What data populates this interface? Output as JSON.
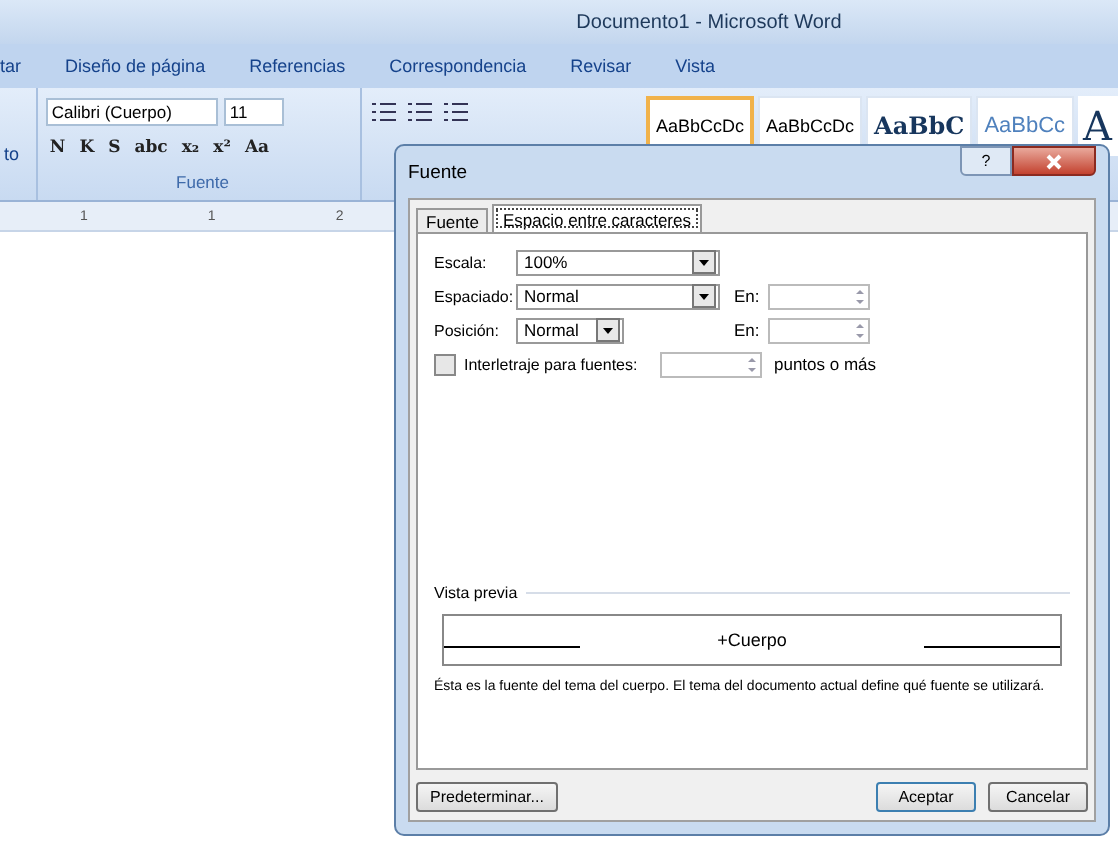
{
  "window": {
    "title": "Documento1 - Microsoft Word"
  },
  "ribbon_tabs": [
    {
      "label": "tar",
      "selected": false
    },
    {
      "label": "Diseño de página",
      "selected": false
    },
    {
      "label": "Referencias",
      "selected": false
    },
    {
      "label": "Correspondencia",
      "selected": false
    },
    {
      "label": "Revisar",
      "selected": false
    },
    {
      "label": "Vista",
      "selected": false
    }
  ],
  "left_group": {
    "label": "to"
  },
  "font_group": {
    "label": "Fuente",
    "font_name": "Calibri (Cuerpo)",
    "font_size": "11",
    "format_buttons": [
      "N",
      "K",
      "S",
      "abc",
      "x₂",
      "x²",
      "Aa"
    ]
  },
  "styles_gallery": [
    {
      "sample": "AaBbCcDc",
      "selected": true,
      "kind": "normal"
    },
    {
      "sample": "AaBbCcDc",
      "selected": false,
      "kind": "normal"
    },
    {
      "sample": "AaBbC",
      "selected": false,
      "kind": "heading1"
    },
    {
      "sample": "AaBbCc",
      "selected": false,
      "kind": "heading2"
    },
    {
      "sample": "A",
      "selected": false,
      "kind": "title"
    }
  ],
  "ruler_labels": [
    "1",
    "1",
    "2"
  ],
  "dialog": {
    "title": "Fuente",
    "help": "?",
    "tabs": [
      {
        "label": "Fuente",
        "selected": false
      },
      {
        "label": "Espacio entre caracteres",
        "selected": true
      }
    ],
    "rows": [
      {
        "kind": "combo",
        "label": "Escala:",
        "value": "100%",
        "wide": true
      },
      {
        "kind": "combo",
        "label": "Espaciado:",
        "value": "Normal",
        "wide": true,
        "spinner_label": "En:"
      },
      {
        "kind": "combo",
        "label": "Posición:",
        "value": "Normal",
        "wide": false,
        "spinner_label": "En:"
      },
      {
        "kind": "check",
        "label": "Interletraje para fuentes:",
        "checked": false,
        "suffix": "puntos o más"
      }
    ],
    "preview": {
      "heading": "Vista previa",
      "sample": "+Cuerpo",
      "note": "Ésta es la fuente del tema del cuerpo. El tema del documento actual define qué fuente se utilizará."
    },
    "buttons": {
      "default": "Predeterminar...",
      "ok": "Aceptar",
      "cancel": "Cancelar"
    }
  }
}
